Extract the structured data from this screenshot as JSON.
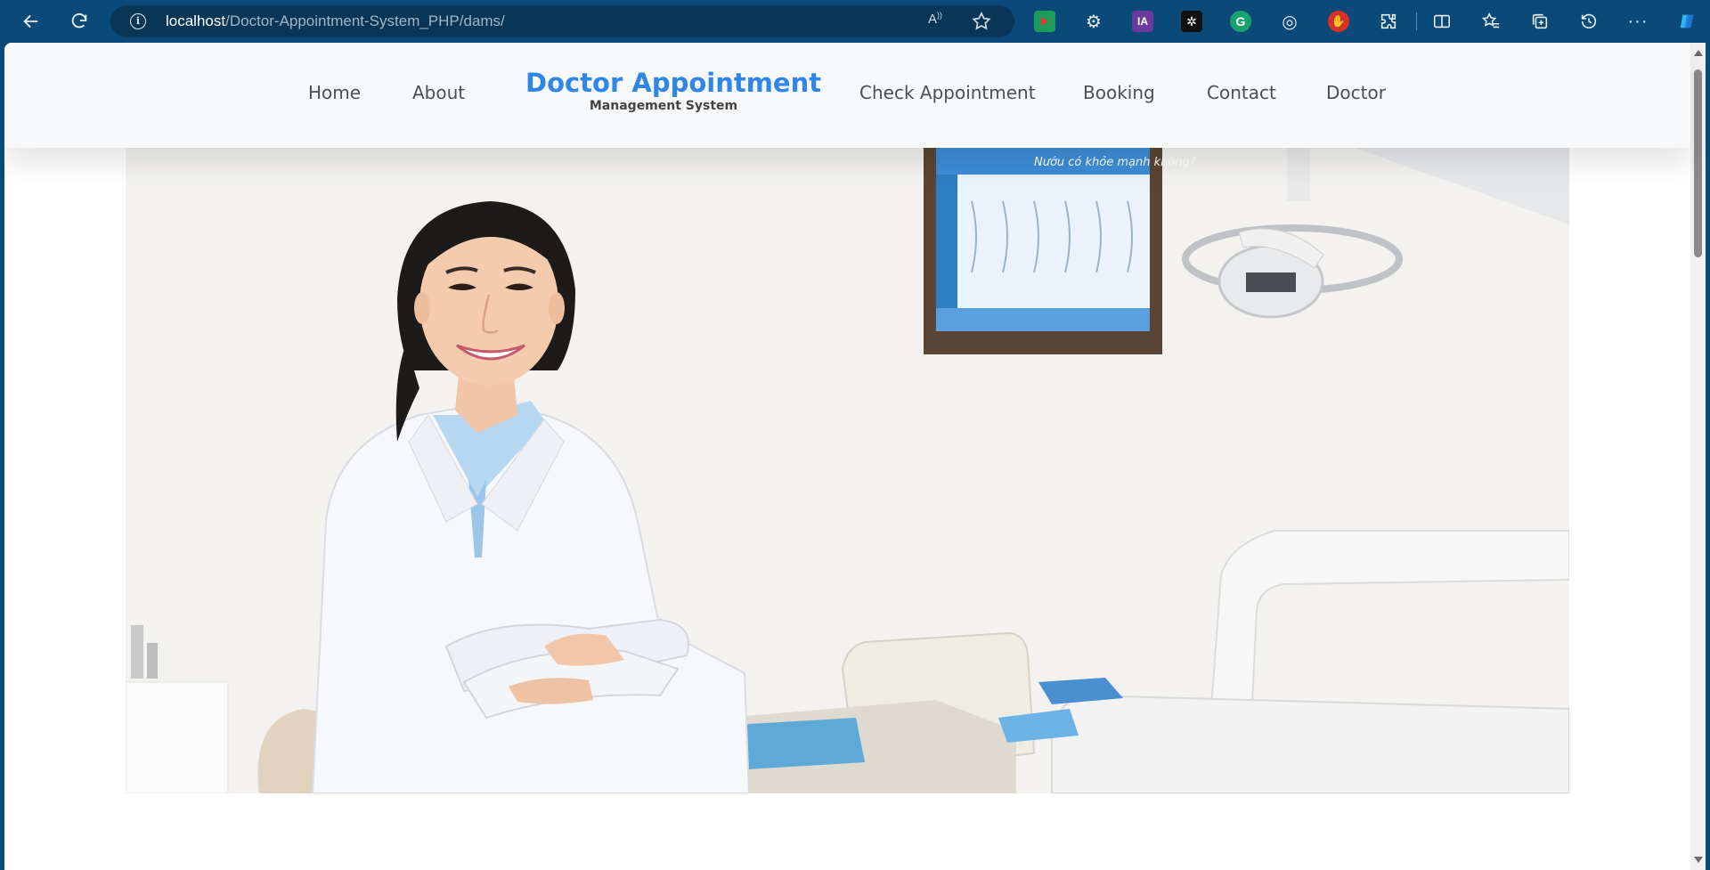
{
  "browser": {
    "url_host": "localhost",
    "url_path": "/Doctor-Appointment-System_PHP/dams/",
    "read_aloud_label": "A",
    "extensions": [
      {
        "name": "video-extension-icon",
        "color": "#1a9c5a",
        "label": "▶"
      },
      {
        "name": "gear-extension-icon",
        "color": "transparent",
        "label": "⚙"
      },
      {
        "name": "ia-extension-icon",
        "color": "#6a3a9c",
        "label": "IA"
      },
      {
        "name": "chatgpt-extension-icon",
        "color": "#111111",
        "label": "✲"
      },
      {
        "name": "grammarly-extension-icon",
        "color": "#15a36b",
        "label": "G"
      },
      {
        "name": "target-extension-icon",
        "color": "transparent",
        "label": "◎"
      },
      {
        "name": "hand-extension-icon",
        "color": "#d9302a",
        "label": "✋"
      },
      {
        "name": "puzzle-extension-icon",
        "color": "transparent",
        "label": "⧉"
      }
    ]
  },
  "nav": {
    "home": "Home",
    "about": "About",
    "brand_title": "Doctor Appointment",
    "brand_subtitle": "Management System",
    "check_appointment": "Check Appointment",
    "booking": "Booking",
    "contact": "Contact",
    "doctor": "Doctor"
  },
  "colors": {
    "brand_blue": "#2f86e8",
    "browser_toolbar": "#0b4a78",
    "nav_background": "#f8f9fa",
    "nav_text": "#4b4f55"
  },
  "hero": {
    "image_subject": "smiling-doctor-in-dental-clinic",
    "poster_heading": "Nướu có khỏe mạnh không?"
  }
}
